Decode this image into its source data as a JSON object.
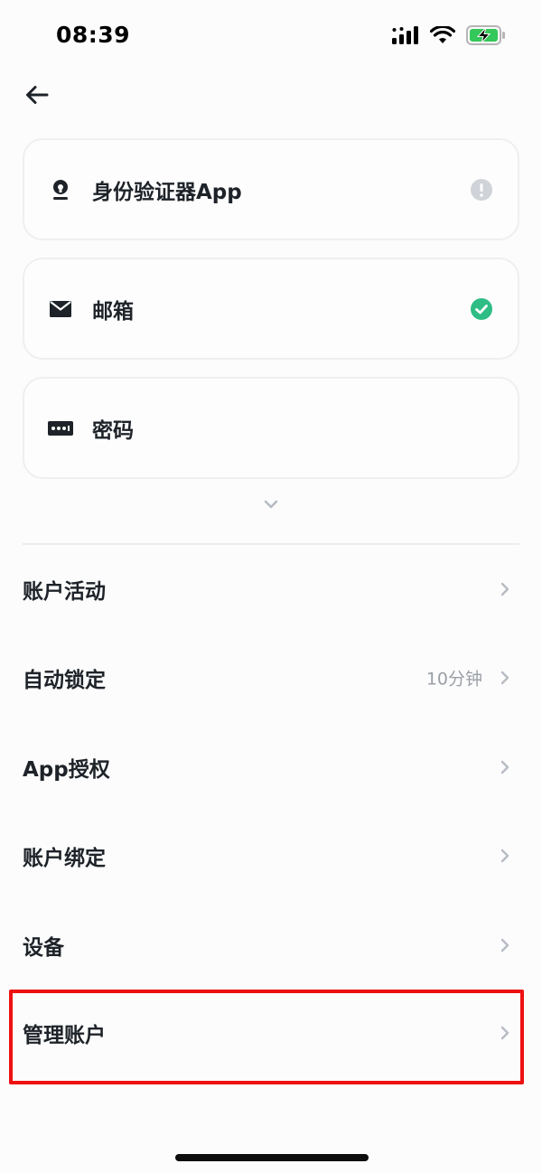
{
  "status_bar": {
    "time": "08:39",
    "signal_icon": "signal-bars-icon",
    "wifi_icon": "wifi-icon",
    "battery_icon": "battery-charging-icon",
    "battery_color": "#34c759"
  },
  "header": {
    "back_icon": "arrow-left-icon"
  },
  "security_methods": [
    {
      "icon": "authenticator-icon",
      "label": "身份验证器App",
      "status": "warning",
      "status_icon": "warning-circle-icon",
      "status_color": "#d0d3d8"
    },
    {
      "icon": "mail-icon",
      "label": "邮箱",
      "status": "enabled",
      "status_icon": "check-circle-icon",
      "status_color": "#2ebd85"
    },
    {
      "icon": "password-icon",
      "label": "密码"
    }
  ],
  "expand_icon": "chevron-down-icon",
  "menu": [
    {
      "label": "账户活动"
    },
    {
      "label": "自动锁定",
      "value": "10分钟"
    },
    {
      "label": "App授权"
    },
    {
      "label": "账户绑定"
    },
    {
      "label": "设备"
    },
    {
      "label": "管理账户",
      "highlighted": true
    }
  ],
  "colors": {
    "text_primary": "#1e2329",
    "text_secondary": "#9a9fa6",
    "highlight": "#ee1111"
  }
}
